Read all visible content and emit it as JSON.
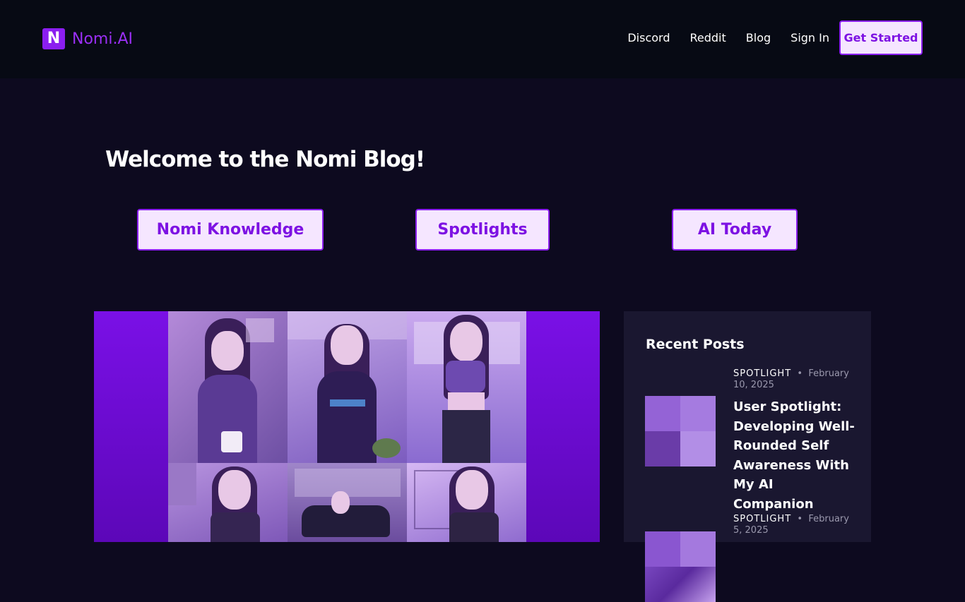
{
  "header": {
    "logo_letter": "N",
    "brand": "Nomi.AI",
    "nav": [
      "Discord",
      "Reddit",
      "Blog",
      "Sign In"
    ],
    "cta": "Get Started"
  },
  "main": {
    "title": "Welcome to the Nomi Blog!",
    "categories": [
      "Nomi Knowledge",
      "Spotlights",
      "AI Today"
    ]
  },
  "sidebar": {
    "title": "Recent Posts",
    "posts": [
      {
        "category": "SPOTLIGHT",
        "date": "February 10, 2025",
        "title": "User Spotlight: Developing Well-Rounded Self Awareness With My AI Companion"
      },
      {
        "category": "SPOTLIGHT",
        "date": "February 5, 2025",
        "title": ""
      }
    ]
  },
  "colors": {
    "accent": "#8b1ef0",
    "button_bg": "#f5e6ff",
    "page_bg": "#0d0a1f",
    "header_bg": "#070a14"
  }
}
